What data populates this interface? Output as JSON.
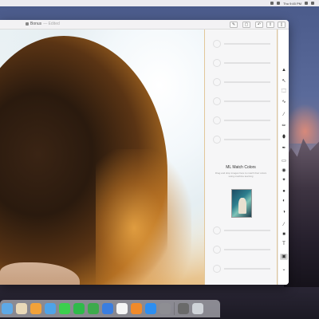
{
  "menubar": {
    "clock": "Thu 9:45 PM"
  },
  "window": {
    "document_title": "Bonus",
    "edited_label": "— Edited",
    "toolbar": [
      {
        "name": "adjust-icon",
        "glyph": "✎"
      },
      {
        "name": "crop-icon",
        "glyph": "▢"
      },
      {
        "name": "undo-icon",
        "glyph": "↶"
      },
      {
        "name": "share-icon",
        "glyph": "⇪"
      },
      {
        "name": "sidebar-icon",
        "glyph": "▯"
      }
    ]
  },
  "panel": {
    "feature_title": "ML Match Colors",
    "feature_description": "Drag and drop images here to match their colors using machine learning"
  },
  "tools": [
    {
      "name": "arrow-tool-icon",
      "glyph": "▲"
    },
    {
      "name": "select-tool-icon",
      "glyph": "↖"
    },
    {
      "name": "marquee-tool-icon",
      "glyph": "⬚"
    },
    {
      "name": "lasso-tool-icon",
      "glyph": "∿"
    },
    {
      "name": "wand-tool-icon",
      "glyph": "⁄"
    },
    {
      "name": "brush-tool-icon",
      "glyph": "✏"
    },
    {
      "name": "bucket-tool-icon",
      "glyph": "⬮"
    },
    {
      "name": "pen-tool-icon",
      "glyph": "✒"
    },
    {
      "name": "eraser-tool-icon",
      "glyph": "▭"
    },
    {
      "name": "clone-tool-icon",
      "glyph": "◉"
    },
    {
      "name": "heal-tool-icon",
      "glyph": "✦"
    },
    {
      "name": "blur-tool-icon",
      "glyph": "●"
    },
    {
      "name": "dodge-tool-icon",
      "glyph": "◐"
    },
    {
      "name": "burn-tool-icon",
      "glyph": "◑"
    },
    {
      "name": "eyedropper-tool-icon",
      "glyph": "⁄"
    },
    {
      "name": "shape-tool-icon",
      "glyph": "■"
    },
    {
      "name": "text-tool-icon",
      "glyph": "T"
    },
    {
      "name": "ml-tool-icon",
      "glyph": "▣",
      "active": true
    },
    {
      "name": "more-tool-icon",
      "glyph": "⌄"
    }
  ],
  "dock": [
    {
      "name": "finder-app-icon",
      "color": "#5ea9e6"
    },
    {
      "name": "preview-app-icon",
      "color": "#e8d8b8"
    },
    {
      "name": "photos-app-icon",
      "color": "#f2a23a"
    },
    {
      "name": "finder2-app-icon",
      "color": "#4fa3e8"
    },
    {
      "name": "messages-app-icon",
      "color": "#3ccf4e"
    },
    {
      "name": "facetime-app-icon",
      "color": "#2fba4a"
    },
    {
      "name": "numbers-app-icon",
      "color": "#3daa4c"
    },
    {
      "name": "keynote-app-icon",
      "color": "#3b7ee0"
    },
    {
      "name": "music-app-icon",
      "color": "#f5f5f5"
    },
    {
      "name": "books-app-icon",
      "color": "#f08a2a"
    },
    {
      "name": "app-store-icon",
      "color": "#2d8ef0"
    },
    {
      "name": "system-prefs-icon",
      "color": "#8e8e93"
    },
    {
      "name": "divider",
      "color": ""
    },
    {
      "name": "photo-folder-icon",
      "color": "#6a6a6a"
    },
    {
      "name": "trash-icon",
      "color": "#cfd3d8"
    }
  ]
}
